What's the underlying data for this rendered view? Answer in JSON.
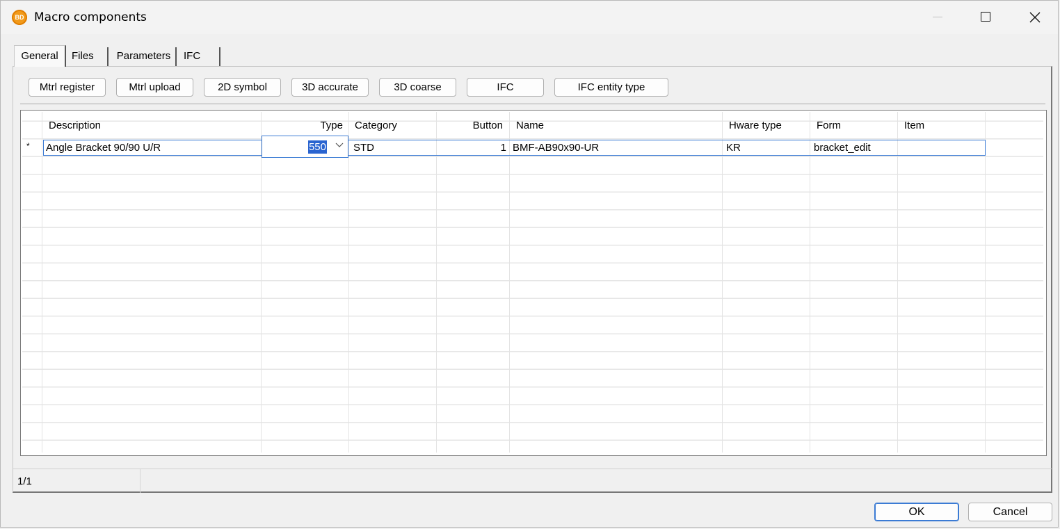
{
  "window": {
    "title": "Macro components",
    "app_icon_text": "BD"
  },
  "tabs": [
    {
      "label": "General",
      "active": true
    },
    {
      "label": "Files"
    },
    {
      "label": "Parameters"
    },
    {
      "label": "IFC"
    }
  ],
  "toolbar": {
    "buttons": [
      "Mtrl register",
      "Mtrl upload",
      "2D symbol",
      "3D accurate",
      "3D coarse",
      "IFC",
      "IFC entity type"
    ]
  },
  "grid": {
    "columns": [
      "Description",
      "Type",
      "Category",
      "Button",
      "Name",
      "Hware type",
      "Form",
      "Item"
    ],
    "row_marker": "*",
    "rows": [
      {
        "description": "Angle Bracket 90/90 U/R",
        "type": "550",
        "category": "STD",
        "button": "1",
        "name": "BMF-AB90x90-UR",
        "hware_type": "KR",
        "form": "bracket_edit",
        "item": ""
      }
    ]
  },
  "status": {
    "record": "1/1"
  },
  "dialog_buttons": {
    "ok": "OK",
    "cancel": "Cancel"
  },
  "colors": {
    "selection": "#2a64d0",
    "focus_border": "#3b7bd4",
    "app_icon": "#f29a1a"
  }
}
